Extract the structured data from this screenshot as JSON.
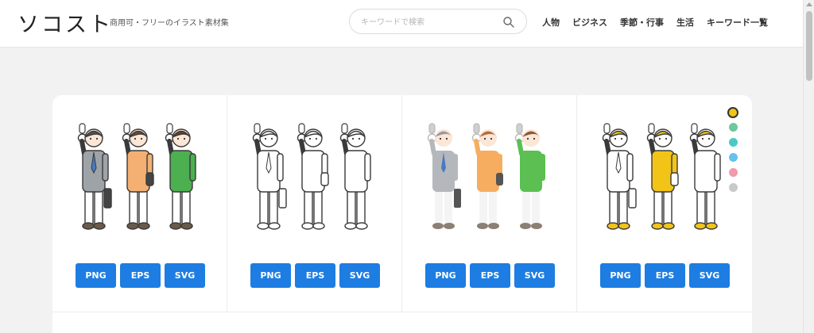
{
  "header": {
    "logo": "ソコスト",
    "tagline": "商用可・フリーのイラスト素材集",
    "search_placeholder": "キーワードで検索",
    "nav": [
      "人物",
      "ビジネス",
      "季節・行事",
      "生活",
      "キーワード一覧"
    ]
  },
  "cards": [
    {
      "variant": "color",
      "buttons": [
        "PNG",
        "EPS",
        "SVG"
      ]
    },
    {
      "variant": "line",
      "buttons": [
        "PNG",
        "EPS",
        "SVG"
      ]
    },
    {
      "variant": "flat",
      "buttons": [
        "PNG",
        "EPS",
        "SVG"
      ]
    },
    {
      "variant": "yellow",
      "buttons": [
        "PNG",
        "EPS",
        "SVG"
      ]
    }
  ],
  "color_swatches": [
    "#f2c418",
    "#6cc99a",
    "#4cc9c3",
    "#66c1ee",
    "#f09aad",
    "#c9c9c9"
  ],
  "colors": {
    "accent": "#1d7de2"
  }
}
